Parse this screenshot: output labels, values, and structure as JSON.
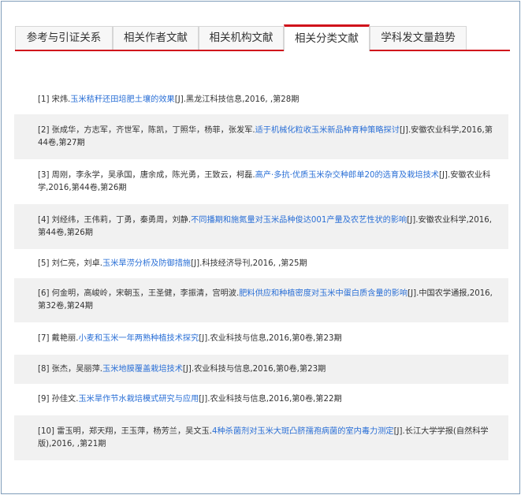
{
  "tabs": [
    {
      "label": "参考与引证关系"
    },
    {
      "label": "相关作者文献"
    },
    {
      "label": "相关机构文献"
    },
    {
      "label": "相关分类文献"
    },
    {
      "label": "学科发文量趋势"
    }
  ],
  "references": [
    {
      "num": "[1] ",
      "authors": "宋炜.",
      "title": "玉米秸秆还田培肥土壤的效果",
      "source": "[J].黑龙江科技信息,2016, ,第28期"
    },
    {
      "num": "[2] ",
      "authors": "张成华，方志军，齐世军，陈凯，丁照华，杨菲，张发军.",
      "title": "适于机械化粒收玉米新品种育种策略探讨",
      "source": "[J].安徽农业科学,2016,第44卷,第27期"
    },
    {
      "num": "[3] ",
      "authors": "周刚，李永学，吴承国，唐余成，陈光勇，王致云，柯磊.",
      "title": "高产·多抗·优质玉米杂交种郎单20的选育及栽培技术",
      "source": "[J].安徽农业科学,2016,第44卷,第26期"
    },
    {
      "num": "[4] ",
      "authors": "刘经纬，王伟莉，丁勇，秦勇周，刘静.",
      "title": "不同播期和施氮量对玉米品种俊达001产量及农艺性状的影响",
      "source": "[J].安徽农业科学,2016,第44卷,第26期"
    },
    {
      "num": "[5] ",
      "authors": "刘仁亮，刘卓.",
      "title": "玉米旱涝分析及防御措施",
      "source": "[J].科技经济导刊,2016, ,第25期"
    },
    {
      "num": "[6] ",
      "authors": "何金明，高峻岭，宋朝玉，王圣健，李振清，宫明波.",
      "title": "肥料供应和种植密度对玉米中蛋白质含量的影响",
      "source": "[J].中国农学通报,2016,第32卷,第24期"
    },
    {
      "num": "[7] ",
      "authors": "戴艳丽.",
      "title": "小麦和玉米一年两熟种植技术探究",
      "source": "[J].农业科技与信息,2016,第0卷,第23期"
    },
    {
      "num": "[8] ",
      "authors": "张杰，吴丽萍.",
      "title": "玉米地膜覆盖栽培技术",
      "source": "[J].农业科技与信息,2016,第0卷,第23期"
    },
    {
      "num": "[9] ",
      "authors": "孙佳文.",
      "title": "玉米旱作节水栽培模式研究与应用",
      "source": "[J].农业科技与信息,2016,第0卷,第22期"
    },
    {
      "num": "[10] ",
      "authors": "雷玉明，郑天翔，王玉萍，杨芳兰，吴文玉.",
      "title": "4种杀菌剂对玉米大斑凸脐孺孢病菌的室内毒力测定",
      "source": "[J].长江大学学报(自然科学版),2016, ,第21期"
    }
  ],
  "colors": {
    "accent": "#d0111b",
    "link": "#2a6fd6",
    "row_shade": "#f1f1f1",
    "frame": "#7f9db9"
  }
}
